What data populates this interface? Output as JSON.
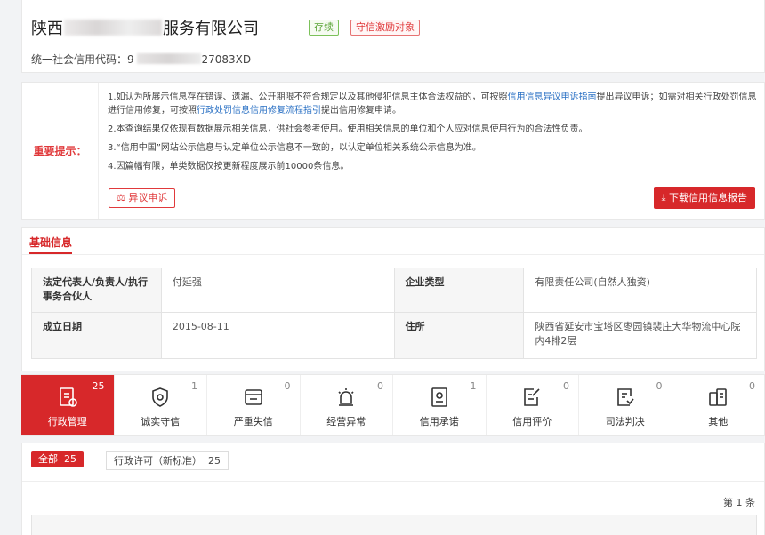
{
  "company": {
    "name_start": "陕西",
    "name_end": "服务有限公司",
    "status_tag": "存续",
    "incentive_tag": "守信激励对象",
    "credit_code_label": "统一社会信用代码：",
    "credit_code_start": "9",
    "credit_code_end": "27083XD"
  },
  "notice": {
    "label": "重要提示：",
    "p1_a": "1.如认为所展示信息存在错误、遗漏、公开期限不符合规定以及其他侵犯信息主体合法权益的，可按照",
    "p1_link1": "信用信息异议申诉指南",
    "p1_b": "提出异议申诉；如需对相关行政处罚信息进行信用修复，可按照",
    "p1_link2": "行政处罚信息信用修复流程指引",
    "p1_c": "提出信用修复申请。",
    "p2": "2.本查询结果仅依现有数据展示相关信息，供社会参考使用。使用相关信息的单位和个人应对信息使用行为的合法性负责。",
    "p3": "3.“信用中国”网站公示信息与认定单位公示信息不一致的，以认定单位相关系统公示信息为准。",
    "p4": "4.因篇幅有限，单类数据仅按更新程度展示前10000条信息。",
    "appeal_button": "异议申诉",
    "download_button": "下载信用信息报告"
  },
  "basic": {
    "title": "基础信息",
    "legal_rep_label": "法定代表人/负责人/执行事务合伙人",
    "legal_rep_value": "付延强",
    "type_label": "企业类型",
    "type_value": "有限责任公司(自然人独资)",
    "date_label": "成立日期",
    "date_value": "2015-08-11",
    "address_label": "住所",
    "address_value": "陕西省延安市宝塔区枣园镇裴庄大华物流中心院内4排2层"
  },
  "tabs": [
    {
      "label": "行政管理",
      "count": "25",
      "icon": "admin-doc-icon"
    },
    {
      "label": "诚实守信",
      "count": "1",
      "icon": "shield-icon"
    },
    {
      "label": "严重失信",
      "count": "0",
      "icon": "warning-card-icon"
    },
    {
      "label": "经营异常",
      "count": "0",
      "icon": "alarm-icon"
    },
    {
      "label": "信用承诺",
      "count": "1",
      "icon": "promise-doc-icon"
    },
    {
      "label": "信用评价",
      "count": "0",
      "icon": "evaluation-icon"
    },
    {
      "label": "司法判决",
      "count": "0",
      "icon": "judgment-icon"
    },
    {
      "label": "其他",
      "count": "0",
      "icon": "other-doc-icon"
    }
  ],
  "list": {
    "all_label": "全部",
    "all_count": "25",
    "sub_label": "行政许可（新标准）",
    "sub_count": "25",
    "page_count": "第 1 条"
  },
  "colors": {
    "accent": "#d7282a",
    "link": "#2b71c4",
    "status_green": "#5aa436"
  }
}
